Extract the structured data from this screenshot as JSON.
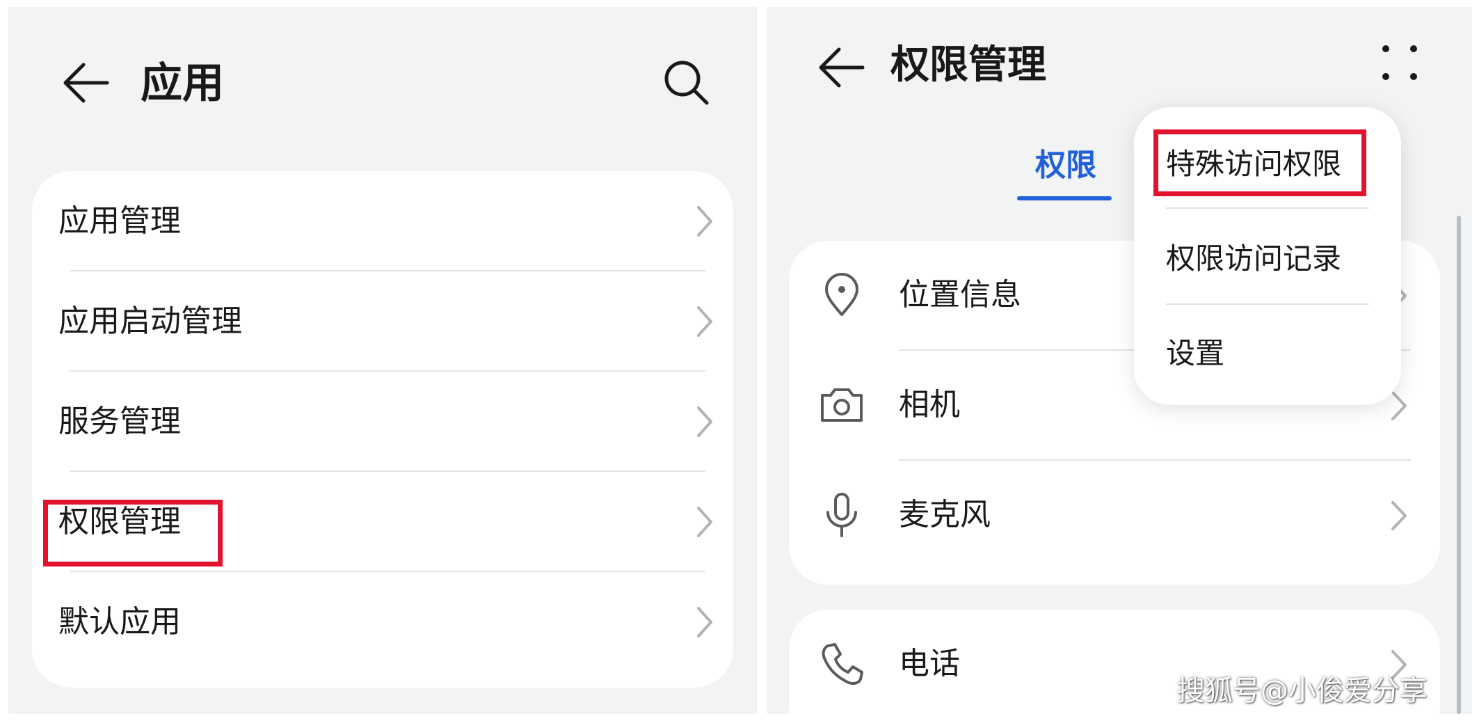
{
  "left_screen": {
    "title": "应用",
    "icons": {
      "back": "arrow-left-icon",
      "search": "search-icon",
      "chevron": "chevron-right-icon"
    },
    "menu_items": [
      {
        "label": "应用管理"
      },
      {
        "label": "应用启动管理"
      },
      {
        "label": "服务管理"
      },
      {
        "label": "权限管理",
        "highlighted": true
      },
      {
        "label": "默认应用"
      }
    ]
  },
  "right_screen": {
    "title": "权限管理",
    "icons": {
      "back": "arrow-left-icon",
      "more": "more-dots-icon"
    },
    "active_tab": "权限",
    "permissions": [
      {
        "label": "位置信息",
        "icon": "location-pin-icon"
      },
      {
        "label": "相机",
        "icon": "camera-icon"
      },
      {
        "label": "麦克风",
        "icon": "microphone-icon"
      },
      {
        "label": "电话",
        "icon": "phone-icon"
      }
    ],
    "popup_menu": [
      {
        "label": "特殊访问权限",
        "highlighted": true
      },
      {
        "label": "权限访问记录"
      },
      {
        "label": "设置"
      }
    ]
  },
  "watermark": "搜狐号@小俊爱分享",
  "colors": {
    "accent": "#2160d8",
    "highlight_box": "#e3122d",
    "background": "#f1f3f5",
    "card": "#ffffff"
  }
}
